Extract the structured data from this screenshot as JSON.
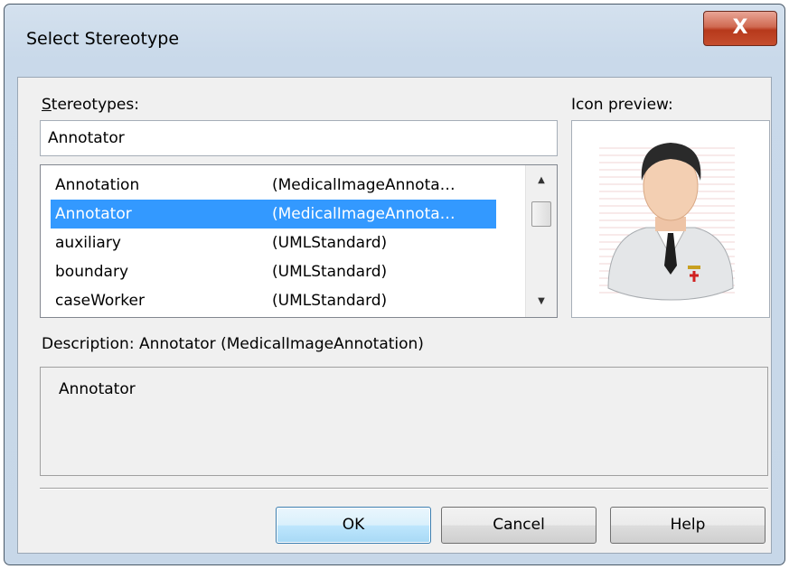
{
  "window": {
    "title": "Select Stereotype",
    "close_glyph": "X"
  },
  "stereotypes": {
    "label_prefix": "S",
    "label_rest": "tereotypes:",
    "input_value": "Annotator",
    "items": [
      {
        "name": "Annotation",
        "profile": "(MedicalImageAnnota…",
        "selected": false
      },
      {
        "name": "Annotator",
        "profile": "(MedicalImageAnnota…",
        "selected": true
      },
      {
        "name": "auxiliary",
        "profile": "(UMLStandard)",
        "selected": false
      },
      {
        "name": "boundary",
        "profile": "(UMLStandard)",
        "selected": false
      },
      {
        "name": "caseWorker",
        "profile": "(UMLStandard)",
        "selected": false
      }
    ]
  },
  "icon_preview": {
    "label": "Icon preview:",
    "icon": "doctor-icon"
  },
  "description": {
    "label": "Description: Annotator (MedicalImageAnnotation)",
    "text": "Annotator"
  },
  "buttons": {
    "ok": "OK",
    "cancel": "Cancel",
    "help": "Help"
  },
  "colors": {
    "selection": "#3399ff",
    "close_button": "#c54d2d",
    "default_button": "#3c7fb1"
  }
}
